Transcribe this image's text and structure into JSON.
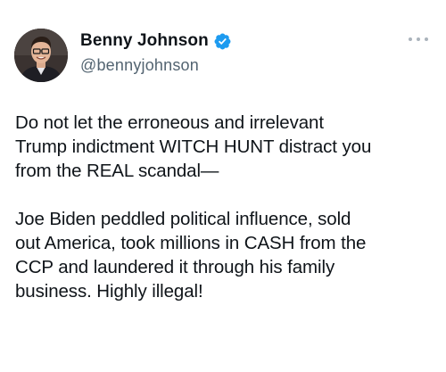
{
  "author": {
    "display_name": "Benny Johnson",
    "handle": "@bennyjohnson",
    "verified": true,
    "verified_color": "#1d9bf0"
  },
  "menu": {
    "icon": "more-horizontal-icon"
  },
  "tweet": {
    "paragraphs": [
      {
        "lines": [
          "Do not let the erroneous and irrelevant",
          "Trump indictment WITCH HUNT distract you",
          "from the REAL scandal—"
        ]
      },
      {
        "lines": [
          "Joe Biden peddled political influence, sold",
          "out America, took millions in CASH from the",
          "CCP and laundered it through his family",
          "business. Highly illegal!"
        ]
      }
    ]
  }
}
